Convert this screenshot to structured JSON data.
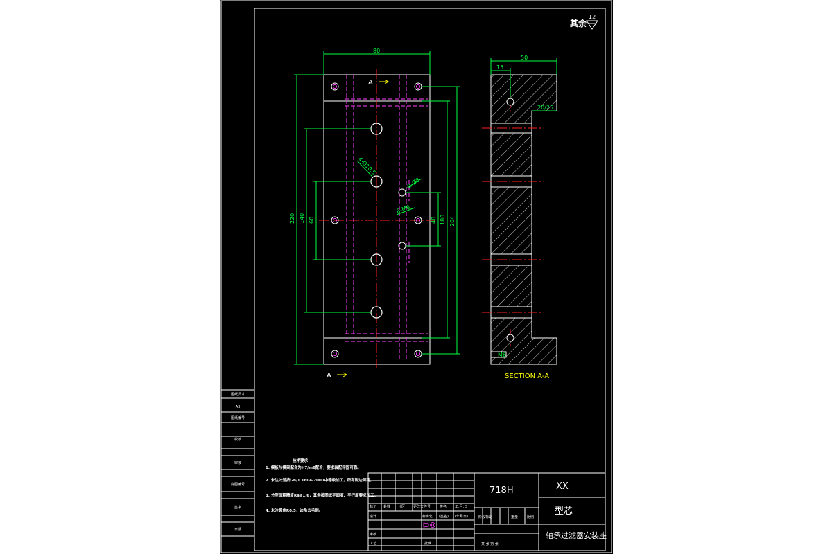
{
  "drawing": {
    "roughness_note": "其余",
    "roughness_value": "12",
    "section_label": "SECTION  A-A",
    "section_mark": "A",
    "dimensions": {
      "width_80": "80",
      "height_220": "220",
      "height_140": "140",
      "height_60": "60",
      "height_40": "40",
      "height_180": "180",
      "height_204": "204",
      "hole_d10": "4-Ø10.5",
      "hole_d8": "2-Ø8",
      "hole_m6": "6-M6",
      "side_50": "50",
      "side_15": "15",
      "side_20": "20/25",
      "side_m6": "M6"
    }
  },
  "tech_requirements": {
    "heading": "技术要求",
    "items": [
      "1. 模板与模架配合为H7/m6配合，要求装配牢固可靠。",
      "2. 未注公差按GB/T 1804-2000中等级加工，所有锐边倒钝。",
      "3. 分型面粗糙度Ra≤1.6，其余按图纸平面度、平行度要求加工。",
      "4. 未注圆角R0.5，边角去毛刺。"
    ]
  },
  "left_strip": {
    "items": [
      "图纸尺寸",
      "A3",
      "图纸编号",
      "校核",
      "审核",
      "底图编号",
      "签字",
      "日期"
    ]
  },
  "title_block": {
    "material": "718H",
    "company": "XX",
    "part_type": "型芯",
    "part_name": "轴承过滤器安装座",
    "stage_headers": [
      "阶段标记",
      "重量",
      "比例"
    ],
    "stage_sub": "共   张   第   张",
    "rev_headers": [
      "标记",
      "处数",
      "分区",
      "更改文件号",
      "签名",
      "年.月.日"
    ],
    "sign_rows": [
      "设计",
      "审核",
      "工艺"
    ],
    "std_label": "标准化",
    "sign_label": "(签名)",
    "date_label": "(年月日)",
    "approve": "批准"
  }
}
